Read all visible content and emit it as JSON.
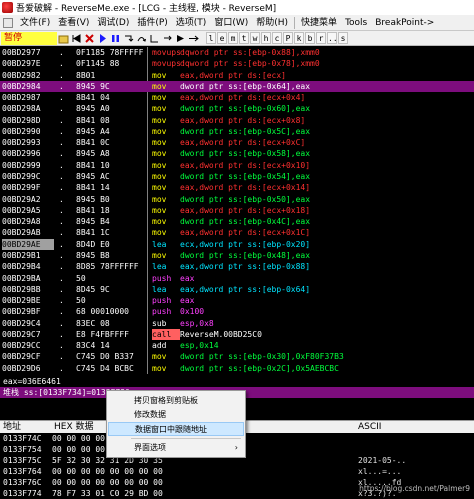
{
  "window": {
    "title": "吾爱破解 - ReverseMe.exe - [LCG - 主线程, 模块 - ReverseM]"
  },
  "menu": {
    "items": [
      "文件(F)",
      "查看(V)",
      "调试(D)",
      "插件(P)",
      "选项(T)",
      "窗口(W)",
      "帮助(H)"
    ],
    "right_items": [
      "快捷菜单",
      "Tools",
      "BreakPoint->"
    ]
  },
  "toolbar": {
    "status": "暂停",
    "letters": [
      "l",
      "e",
      "m",
      "t",
      "w",
      "h",
      "c",
      "P",
      "k",
      "b",
      "r",
      "...",
      "s"
    ]
  },
  "colors": {
    "background": "#000000",
    "selection": "#7d0d7d",
    "mnemonic_mov": "#ffff00",
    "mnemonic_lea": "#00e5ff",
    "mnemonic_push": "#ff40ff",
    "mnemonic_call": "#ff6060",
    "operand": "#00ff3c",
    "comment": "#ff3030"
  },
  "cpu_rows": [
    {
      "addr": "00BD2977",
      "mark": ".",
      "hex": "0F1185 78FFFFF",
      "mn": "movups",
      "mncolor": "#ff3030",
      "ops": "dqword ptr ss:[ebp-0x88],xmm0",
      "opcolor": "#ff3030"
    },
    {
      "addr": "00BD297E",
      "mark": ".",
      "hex": "0F1145 88",
      "mn": "movups",
      "mncolor": "#ff3030",
      "ops": "dqword ptr ss:[ebp-0x78],xmm0",
      "opcolor": "#ff3030"
    },
    {
      "addr": "00BD2982",
      "mark": ".",
      "hex": "8B01",
      "mn": "mov",
      "mncolor": "#ffff00",
      "ops": "eax,dword ptr ds:[ecx]",
      "opcolor": "#ff3030"
    },
    {
      "addr": "00BD2984",
      "mark": ".",
      "hex": "8945 9C",
      "mn": "mov",
      "mncolor": "#ffff00",
      "ops": "dword ptr ss:[ebp-0x64],eax",
      "opcolor": "#ffffff",
      "sel": true
    },
    {
      "addr": "00BD2987",
      "mark": ".",
      "hex": "8B41 04",
      "mn": "mov",
      "mncolor": "#ffff00",
      "ops": "eax,dword ptr ds:[ecx+0x4]",
      "opcolor": "#ff3030"
    },
    {
      "addr": "00BD298A",
      "mark": ".",
      "hex": "8945 A0",
      "mn": "mov",
      "mncolor": "#ffff00",
      "ops": "dword ptr ss:[ebp-0x60],eax",
      "opcolor": "#00ff3c"
    },
    {
      "addr": "00BD298D",
      "mark": ".",
      "hex": "8B41 08",
      "mn": "mov",
      "mncolor": "#ffff00",
      "ops": "eax,dword ptr ds:[ecx+0x8]",
      "opcolor": "#ff3030"
    },
    {
      "addr": "00BD2990",
      "mark": ".",
      "hex": "8945 A4",
      "mn": "mov",
      "mncolor": "#ffff00",
      "ops": "dword ptr ss:[ebp-0x5C],eax",
      "opcolor": "#00ff3c"
    },
    {
      "addr": "00BD2993",
      "mark": ".",
      "hex": "8B41 0C",
      "mn": "mov",
      "mncolor": "#ffff00",
      "ops": "eax,dword ptr ds:[ecx+0xC]",
      "opcolor": "#ff3030"
    },
    {
      "addr": "00BD2996",
      "mark": ".",
      "hex": "8945 A8",
      "mn": "mov",
      "mncolor": "#ffff00",
      "ops": "dword ptr ss:[ebp-0x58],eax",
      "opcolor": "#00ff3c"
    },
    {
      "addr": "00BD2999",
      "mark": ".",
      "hex": "8B41 10",
      "mn": "mov",
      "mncolor": "#ffff00",
      "ops": "eax,dword ptr ds:[ecx+0x10]",
      "opcolor": "#ff3030"
    },
    {
      "addr": "00BD299C",
      "mark": ".",
      "hex": "8945 AC",
      "mn": "mov",
      "mncolor": "#ffff00",
      "ops": "dword ptr ss:[ebp-0x54],eax",
      "opcolor": "#00ff3c"
    },
    {
      "addr": "00BD299F",
      "mark": ".",
      "hex": "8B41 14",
      "mn": "mov",
      "mncolor": "#ffff00",
      "ops": "eax,dword ptr ds:[ecx+0x14]",
      "opcolor": "#ff3030"
    },
    {
      "addr": "00BD29A2",
      "mark": ".",
      "hex": "8945 B0",
      "mn": "mov",
      "mncolor": "#ffff00",
      "ops": "dword ptr ss:[ebp-0x50],eax",
      "opcolor": "#00ff3c"
    },
    {
      "addr": "00BD29A5",
      "mark": ".",
      "hex": "8B41 18",
      "mn": "mov",
      "mncolor": "#ffff00",
      "ops": "eax,dword ptr ds:[ecx+0x18]",
      "opcolor": "#ff3030"
    },
    {
      "addr": "00BD29A8",
      "mark": ".",
      "hex": "8945 B4",
      "mn": "mov",
      "mncolor": "#ffff00",
      "ops": "dword ptr ss:[ebp-0x4C],eax",
      "opcolor": "#00ff3c"
    },
    {
      "addr": "00BD29AB",
      "mark": ".",
      "hex": "8B41 1C",
      "mn": "mov",
      "mncolor": "#ffff00",
      "ops": "eax,dword ptr ds:[ecx+0x1C]",
      "opcolor": "#ff3030"
    },
    {
      "addr": "00BD29AE",
      "mark": ".",
      "hex": "8D4D E0",
      "mn": "lea",
      "mncolor": "#00e5ff",
      "ops": "ecx,dword ptr ss:[ebp-0x20]",
      "opcolor": "#00e5ff",
      "cur": true
    },
    {
      "addr": "00BD29B1",
      "mark": ".",
      "hex": "8945 B8",
      "mn": "mov",
      "mncolor": "#ffff00",
      "ops": "dword ptr ss:[ebp-0x48],eax",
      "opcolor": "#00ff3c"
    },
    {
      "addr": "00BD29B4",
      "mark": ".",
      "hex": "8D85 78FFFFFF",
      "mn": "lea",
      "mncolor": "#00e5ff",
      "ops": "eax,dword ptr ss:[ebp-0x88]",
      "opcolor": "#00e5ff"
    },
    {
      "addr": "00BD29BA",
      "mark": ".",
      "hex": "50",
      "mn": "push",
      "mncolor": "#ff40ff",
      "ops": "eax",
      "opcolor": "#ff40ff"
    },
    {
      "addr": "00BD29BB",
      "mark": ".",
      "hex": "8D45 9C",
      "mn": "lea",
      "mncolor": "#00e5ff",
      "ops": "eax,dword ptr ss:[ebp-0x64]",
      "opcolor": "#00e5ff"
    },
    {
      "addr": "00BD29BE",
      "mark": ".",
      "hex": "50",
      "mn": "push",
      "mncolor": "#ff40ff",
      "ops": "eax",
      "opcolor": "#ff40ff"
    },
    {
      "addr": "00BD29BF",
      "mark": ".",
      "hex": "68 00010000",
      "mn": "push",
      "mncolor": "#ff40ff",
      "ops": "0x100",
      "opcolor": "#ff40ff"
    },
    {
      "addr": "00BD29C4",
      "mark": ".",
      "hex": "83EC 08",
      "mn": "sub",
      "mncolor": "#ffffff",
      "ops": "esp,0x8",
      "opcolor": "#ff40ff"
    },
    {
      "addr": "00BD29C7",
      "mark": ".",
      "hex": "E8 F4FBFFFF",
      "mn": "call",
      "mncolor": "#000000",
      "mnbg": "#ff6060",
      "ops": "ReverseM.00BD25C0",
      "opcolor": "#ffffff"
    },
    {
      "addr": "00BD29CC",
      "mark": ".",
      "hex": "83C4 14",
      "mn": "add",
      "mncolor": "#ffffff",
      "ops": "esp,0x14",
      "opcolor": "#00ff3c"
    },
    {
      "addr": "00BD29CF",
      "mark": ".",
      "hex": "C745 D0 B337",
      "mn": "mov",
      "mncolor": "#ffff00",
      "ops": "dword ptr ss:[ebp-0x30],0xF80F37B3",
      "opcolor": "#00ff3c"
    },
    {
      "addr": "00BD29D6",
      "mark": ".",
      "hex": "C745 D4 BCBC",
      "mn": "mov",
      "mncolor": "#ffff00",
      "ops": "dword ptr ss:[ebp-0x2C],0x5AEBCBC",
      "opcolor": "#00ff3c"
    }
  ],
  "info": {
    "line1": "eax=036E6461",
    "line2": "堆栈 ss:[0133F734]=0133F780"
  },
  "dump": {
    "col_addr": "地址",
    "col_hex": "HEX 数据",
    "col_ascii": "ASCII",
    "rows": [
      {
        "addr": "0133F74C",
        "hex": "00 00 00 00 00 00 00 00",
        "ascii": ""
      },
      {
        "addr": "0133F754",
        "hex": "00 00 00 00 00 00 00 00",
        "ascii": ""
      },
      {
        "addr": "0133F75C",
        "hex": "5F 32 30 32 31 2D 30 35",
        "ascii": "2021-05-.."
      },
      {
        "addr": "0133F764",
        "hex": "00 00 00 00 00 00 00 00",
        "ascii": "xl...=..."
      },
      {
        "addr": "0133F76C",
        "hex": "00 00 00 00 00 00 00 00",
        "ascii": "xl.....fd"
      },
      {
        "addr": "0133F774",
        "hex": "78 F7 33 01 C0 29 BD 00",
        "ascii": "x?3.?)?."
      }
    ]
  },
  "context_menu": {
    "items": [
      {
        "label": "拷贝窗格到剪贴板",
        "highlight": false,
        "submenu": false
      },
      {
        "label": "修改数据",
        "highlight": false,
        "submenu": false
      },
      {
        "label": "数据窗口中跟随地址",
        "highlight": true,
        "submenu": false
      },
      {
        "label": "界面选项",
        "highlight": false,
        "submenu": true
      }
    ]
  },
  "watermark": "https://blog.csdn.net/Palmer9"
}
